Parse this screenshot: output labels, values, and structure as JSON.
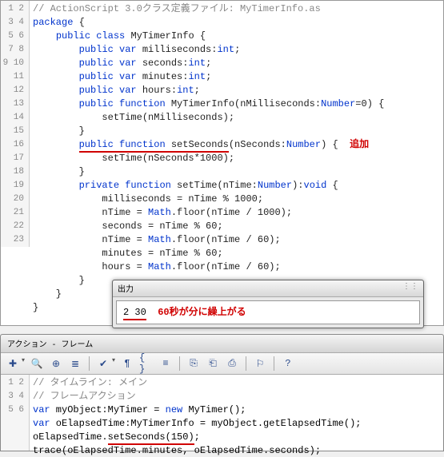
{
  "upper": {
    "lines": [
      {
        "n": 1,
        "indent": 0,
        "html": "<span class='com'>// ActionScript 3.0クラス定義ファイル: MyTimerInfo.as</span>"
      },
      {
        "n": 2,
        "indent": 0,
        "html": "<span class='kw'>package</span> {"
      },
      {
        "n": 3,
        "indent": 1,
        "html": "<span class='kw'>public</span> <span class='kw'>class</span> MyTimerInfo {"
      },
      {
        "n": 4,
        "indent": 2,
        "html": "<span class='kw'>public</span> <span class='kw'>var</span> milliseconds:<span class='typ'>int</span>;"
      },
      {
        "n": 5,
        "indent": 2,
        "html": "<span class='kw'>public</span> <span class='kw'>var</span> seconds:<span class='typ'>int</span>;"
      },
      {
        "n": 6,
        "indent": 2,
        "html": "<span class='kw'>public</span> <span class='kw'>var</span> minutes:<span class='typ'>int</span>;"
      },
      {
        "n": 7,
        "indent": 2,
        "html": "<span class='kw'>public</span> <span class='kw'>var</span> hours:<span class='typ'>int</span>;"
      },
      {
        "n": 8,
        "indent": 2,
        "html": "<span class='kw'>public</span> <span class='kw'>function</span> MyTimerInfo(nMilliseconds:<span class='typ'>Number</span>=0) {"
      },
      {
        "n": 9,
        "indent": 3,
        "html": "setTime(nMilliseconds);"
      },
      {
        "n": 10,
        "indent": 2,
        "html": "}"
      },
      {
        "n": 11,
        "indent": 2,
        "html": "<span class='underline-red'><span class='kw'>public</span> <span class='kw'>function</span> setSeconds</span>(nSeconds:<span class='typ'>Number</span>) {  <span class='anno'>追加</span>"
      },
      {
        "n": 12,
        "indent": 3,
        "html": "setTime(nSeconds*1000);"
      },
      {
        "n": 13,
        "indent": 2,
        "html": "}"
      },
      {
        "n": 14,
        "indent": 2,
        "html": "<span class='kw'>private</span> <span class='kw'>function</span> setTime(nTime:<span class='typ'>Number</span>):<span class='typ'>void</span> {"
      },
      {
        "n": 15,
        "indent": 3,
        "html": "milliseconds = nTime % 1000;"
      },
      {
        "n": 16,
        "indent": 3,
        "html": "nTime = <span class='typ'>Math</span>.floor(nTime / 1000);"
      },
      {
        "n": 17,
        "indent": 3,
        "html": "seconds = nTime % 60;"
      },
      {
        "n": 18,
        "indent": 3,
        "html": "nTime = <span class='typ'>Math</span>.floor(nTime / 60);"
      },
      {
        "n": 19,
        "indent": 3,
        "html": "minutes = nTime % 60;"
      },
      {
        "n": 20,
        "indent": 3,
        "html": "hours = <span class='typ'>Math</span>.floor(nTime / 60);"
      },
      {
        "n": 21,
        "indent": 2,
        "html": "}"
      },
      {
        "n": 22,
        "indent": 1,
        "html": "}"
      },
      {
        "n": 23,
        "indent": 0,
        "html": "}"
      }
    ]
  },
  "output": {
    "title": "出力",
    "value": "2 30",
    "note": "60秒が分に繰上がる"
  },
  "actions": {
    "title": "アクション - フレーム",
    "tools": [
      "add",
      "find",
      "target",
      "tree",
      "sep",
      "check",
      "auto",
      "brace-l",
      "brace-r",
      "sep",
      "script",
      "script2",
      "script3",
      "sep",
      "flag",
      "sep",
      "help"
    ]
  },
  "lower": {
    "lines": [
      {
        "n": 1,
        "html": "<span class='com'>// タイムライン: メイン</span>"
      },
      {
        "n": 2,
        "html": "<span class='com'>// フレームアクション</span>"
      },
      {
        "n": 3,
        "html": "<span class='kw'>var</span> myObject:MyTimer = <span class='kw'>new</span> MyTimer();"
      },
      {
        "n": 4,
        "html": "<span class='kw'>var</span> oElapsedTime:MyTimerInfo = myObject.getElapsedTime();"
      },
      {
        "n": 5,
        "html": "oElapsedTime.<span class='underline-red'>setSeconds(150)</span>;"
      },
      {
        "n": 6,
        "html": "trace(oElapsedTime.minutes, oElapsedTime.seconds);"
      }
    ]
  },
  "icons": {
    "add": "✚",
    "find": "🔍",
    "target": "⊕",
    "tree": "≣",
    "check": "✔",
    "auto": "¶",
    "brace-l": "{ }",
    "brace-r": "≡",
    "script": "⎘",
    "script2": "⎗",
    "script3": "⎙",
    "flag": "⚐",
    "help": "?"
  }
}
